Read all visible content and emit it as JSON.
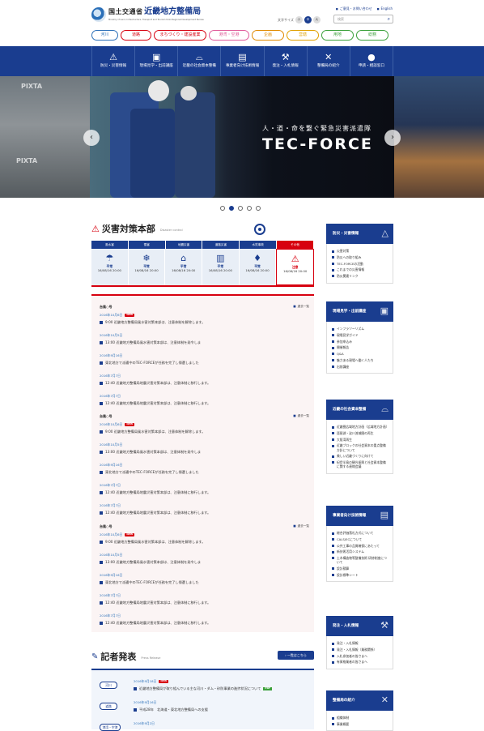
{
  "header": {
    "logo_ministry": "国土交通省",
    "logo_bureau": "近畿地方整備局",
    "logo_sub": "Ministry of Land, Infrastructure, Transport and Tourism Kinki Regional Development Bureau",
    "top_links": [
      "ご意見・お問い合わせ",
      "English"
    ],
    "font_size_label": "文字サイズ",
    "font_sizes": [
      "小",
      "中",
      "大"
    ],
    "search_placeholder": "検索",
    "categories": [
      {
        "label": "河川",
        "color": "#2a6fb8"
      },
      {
        "label": "道路",
        "color": "#d7000f"
      },
      {
        "label": "まちづくり・建設産業",
        "color": "#d7000f"
      },
      {
        "label": "港湾・空港",
        "color": "#e05a9a"
      },
      {
        "label": "企画",
        "color": "#e08a00"
      },
      {
        "label": "営繕",
        "color": "#e0a000"
      },
      {
        "label": "用地",
        "color": "#3aa03a"
      },
      {
        "label": "総務",
        "color": "#3aa03a"
      }
    ]
  },
  "nav": {
    "items": [
      {
        "label": "防災・災害情報",
        "icon": "warning-icon"
      },
      {
        "label": "現場見学・出前講座",
        "icon": "presentation-icon"
      },
      {
        "label": "近畿の社会資本整備",
        "icon": "bridge-icon"
      },
      {
        "label": "事業者向け技術情報",
        "icon": "document-icon"
      },
      {
        "label": "発注・入札情報",
        "icon": "gavel-icon"
      },
      {
        "label": "整備局の紹介",
        "icon": "tools-icon"
      },
      {
        "label": "申請・相談窓口",
        "icon": "person-icon"
      }
    ]
  },
  "hero": {
    "tagline": "人・道・命を繋ぐ緊急災害派遣隊",
    "title": "TEC-FORCE",
    "watermark": "PIXTA",
    "slide_count": 5,
    "active_slide": 2
  },
  "disaster": {
    "title": "災害対策本部",
    "title_en": "Disaster control",
    "categories": [
      {
        "head": "風水害",
        "status": "平常",
        "time": "16/08/16 20:00",
        "icon": "umbrella-icon"
      },
      {
        "head": "雪害",
        "status": "平常",
        "time": "16/08/16 20:00",
        "icon": "snow-icon"
      },
      {
        "head": "地震災害",
        "status": "平常",
        "time": "16/08/16 20:00",
        "icon": "house-icon"
      },
      {
        "head": "道路災害",
        "status": "平常",
        "time": "16/08/16 20:00",
        "icon": "tunnel-icon"
      },
      {
        "head": "水質事故",
        "status": "平常",
        "time": "16/08/16 20:00",
        "icon": "drop-icon"
      },
      {
        "head": "その他",
        "status": "注意",
        "time": "16/08/16 20:00",
        "icon": "warning-icon"
      }
    ],
    "list_link": "過去一覧",
    "groups": [
      {
        "name": "台風○号",
        "items": [
          {
            "date": "2016年10月6日",
            "new": "NEW",
            "text": "9:00 近畿地方整備局風水害対策本部は、注意体制を解除します。"
          },
          {
            "date": "2016年10月5日",
            "new": "",
            "text": "13:00 近畿地方整備局風水害対策本部は、注意体制を発令しま"
          },
          {
            "date": "2016年9月16日",
            "new": "",
            "text": "東北地方で派遣中のTEC-FORCEが任務を完了し帰還しました"
          },
          {
            "date": "2016年7月7日",
            "new": "",
            "text": "12:40 近畿地方整備局地震災害対策本部は、注意体制に移行します。"
          },
          {
            "date": "2016年7月7日",
            "new": "",
            "text": "12:40 近畿地方整備局地震災害対策本部は、注意体制に移行します。"
          }
        ]
      },
      {
        "name": "台風○号",
        "items": [
          {
            "date": "2016年10月6日",
            "new": "NEW",
            "text": "9:00 近畿地方整備局風水害対策本部は、注意体制を解除します。"
          },
          {
            "date": "2016年10月5日",
            "new": "",
            "text": "13:00 近畿地方整備局風水害対策本部は、注意体制を発令しま"
          },
          {
            "date": "2016年9月16日",
            "new": "",
            "text": "東北地方で派遣中のTEC-FORCEが任務を完了し帰還しました"
          },
          {
            "date": "2016年7月7日",
            "new": "",
            "text": "12:40 近畿地方整備局地震災害対策本部は、注意体制に移行します。"
          },
          {
            "date": "2016年7月7日",
            "new": "",
            "text": "12:40 近畿地方整備局地震災害対策本部は、注意体制に移行します。"
          }
        ]
      },
      {
        "name": "台風○号",
        "items": [
          {
            "date": "2016年10月6日",
            "new": "NEW",
            "text": "9:00 近畿地方整備局風水害対策本部は、注意体制を解除します。"
          },
          {
            "date": "2016年10月5日",
            "new": "",
            "text": "13:00 近畿地方整備局風水害対策本部は、注意体制を発令しま"
          },
          {
            "date": "2016年9月16日",
            "new": "",
            "text": "東北地方で派遣中のTEC-FORCEが任務を完了し帰還しました"
          },
          {
            "date": "2016年7月7日",
            "new": "",
            "text": "12:40 近畿地方整備局地震災害対策本部は、注意体制に移行します。"
          },
          {
            "date": "2016年7月7日",
            "new": "",
            "text": "12:40 近畿地方整備局地震災害対策本部は、注意体制に移行します。"
          }
        ]
      }
    ]
  },
  "press": {
    "title": "記者発表",
    "title_en": "Press Release",
    "list_button": "一覧はこちら",
    "items": [
      {
        "tag": "河川",
        "date": "2016年9月18日",
        "new": "NEW",
        "text": "近畿地方整備局が取り組んでいる主な河川・ダム・砂防事業の進捗状況について",
        "pdf": "PDF"
      },
      {
        "tag": "道路",
        "date": "2016年9月16日",
        "new": "",
        "text": "平成28年　北海道・東北地方整備局への支援",
        "pdf": ""
      },
      {
        "tag": "港湾・空港",
        "date": "2016年9月2日",
        "new": "",
        "text": "",
        "pdf": ""
      }
    ]
  },
  "sidebar": [
    {
      "title": "防災・災害情報",
      "icon": "warning-icon",
      "items": [
        "災害対策",
        "防災への取り組み",
        "TEC-FORCEの活動",
        "これまでの災害情報",
        "防災関連リンク"
      ]
    },
    {
      "title": "現場見学・出前講座",
      "icon": "presentation-icon",
      "items": [
        "インフラツーリズム",
        "現場見学ガイド",
        "参加申込み",
        "開催報告",
        "Q&A",
        "魅力ある現場へ働く人たち",
        "出前講座"
      ]
    },
    {
      "title": "近畿の社会資本整備",
      "icon": "bridge-icon",
      "items": [
        "近畿圏広域地方計画（広域地方計画）",
        "琵琶湖・淀川流域圏の再生",
        "大阪湾再生",
        "近畿ブロックの社会資本の重点整備方針について",
        "美しい近畿づくりに向けて",
        "紀伊半島の観光振興と社会資本整備に関する連絡会議"
      ]
    },
    {
      "title": "事業者向け技術情報",
      "icon": "document-icon",
      "items": [
        "総合評価落札方式について",
        "CALS/ECについて",
        "公共工事の品質確保にあたって",
        "新技術活用システム",
        "土木構造物等整備技術 研修制度について",
        "設計積算",
        "設計標準シート"
      ]
    },
    {
      "title": "発注・入札情報",
      "icon": "gavel-icon",
      "items": [
        "発注・入札情報",
        "発注・入札情報（業務関係）",
        "入札参加者の皆さまへ",
        "有資格業者の皆さまへ"
      ]
    },
    {
      "title": "整備局の紹介",
      "icon": "tools-icon",
      "items": [
        "組織体制",
        "事業概要"
      ]
    }
  ]
}
